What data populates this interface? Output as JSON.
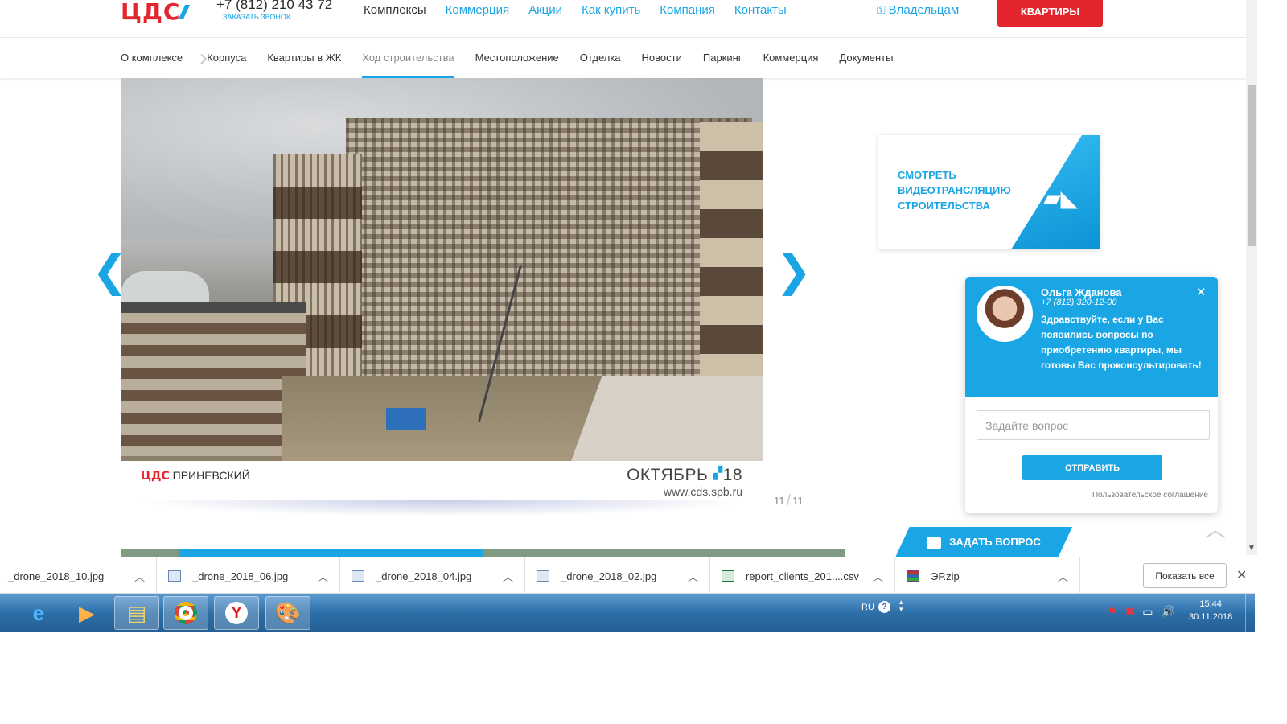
{
  "header": {
    "logo": "ЦДС",
    "phone": "+7 (812) 210 43 72",
    "callback": "ЗАКАЗАТЬ ЗВОНОК",
    "nav": [
      "Комплексы",
      "Коммерция",
      "Акции",
      "Как купить",
      "Компания",
      "Контакты"
    ],
    "owners": "Владельцам",
    "flats_button": "КВАРТИРЫ"
  },
  "subnav": {
    "items": [
      "О комплексе",
      "Корпуса",
      "Квартиры в ЖК",
      "Ход строительства",
      "Местоположение",
      "Отделка",
      "Новости",
      "Паркинг",
      "Коммерция",
      "Документы"
    ],
    "active": "Ход строительства"
  },
  "gallery": {
    "caption_logo": "ЦДС",
    "caption_name": "ПРИНЕВСКИЙ",
    "month": "ОКТЯБРЬ",
    "year": "18",
    "url": "www.cds.spb.ru",
    "current": "11",
    "total": "11",
    "prev_arrow": "❮",
    "next_arrow": "❯"
  },
  "video_card": {
    "line1": "СМОТРЕТЬ",
    "line2": "ВИДЕОТРАНСЛЯЦИЮ",
    "line3": "СТРОИТЕЛЬСТВА"
  },
  "chat": {
    "name": "Ольга Жданова",
    "phone": "+7 (812) 320-12-00",
    "message": "Здравствуйте, если у Вас появились вопросы по приобретению квартиры, мы готовы Вас проконсультировать!",
    "placeholder": "Задайте вопрос",
    "send": "ОТПРАВИТЬ",
    "agreement": "Пользовательское соглашение",
    "close": "✕"
  },
  "ask_tab": "ЗАДАТЬ ВОПРОС",
  "downloads": {
    "items": [
      {
        "name": "_drone_2018_10.jpg",
        "type": "jpg"
      },
      {
        "name": "_drone_2018_06.jpg",
        "type": "jpg"
      },
      {
        "name": "_drone_2018_04.jpg",
        "type": "jpg"
      },
      {
        "name": "_drone_2018_02.jpg",
        "type": "jpg"
      },
      {
        "name": "report_clients_201....csv",
        "type": "csv"
      },
      {
        "name": "ЭР.zip",
        "type": "zip"
      }
    ],
    "show_all": "Показать все",
    "close": "✕"
  },
  "taskbar": {
    "apps": [
      "internet-explorer-icon",
      "media-player-icon",
      "file-explorer-icon",
      "chrome-icon",
      "yandex-browser-icon",
      "paint-icon"
    ],
    "lang": "RU",
    "help": "?",
    "time": "15:44",
    "date": "30.11.2018"
  },
  "colors": {
    "accent": "#1aa6e4",
    "brand_red": "#e3262e"
  }
}
